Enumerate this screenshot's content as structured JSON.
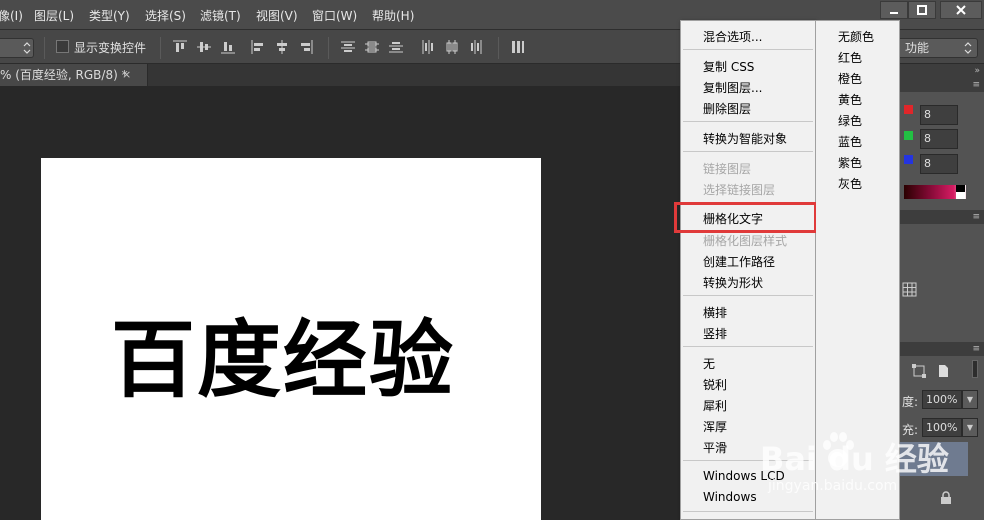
{
  "menubar": {
    "items": [
      "像(I)",
      "图层(L)",
      "类型(Y)",
      "选择(S)",
      "滤镜(T)",
      "视图(V)",
      "窗口(W)",
      "帮助(H)"
    ]
  },
  "options": {
    "checkbox_label": "显示变换控件",
    "workspace_label": "功能"
  },
  "document": {
    "tab_title": "% (百度经验, RGB/8) *",
    "close_glyph": "×",
    "canvas_text": "百度经验"
  },
  "panels": {
    "rgb_values": [
      "8",
      "8",
      "8"
    ],
    "swatch_colors": [
      "#e0262a",
      "#22c043",
      "#2434e0"
    ],
    "opacity_label": "度:",
    "opacity_value": "100%",
    "fill_label": "充:",
    "fill_value": "100%"
  },
  "context_menu": {
    "items": [
      {
        "label": "混合选项...",
        "disabled": false
      },
      {
        "label": "复制 CSS",
        "disabled": false
      },
      {
        "label": "复制图层...",
        "disabled": false
      },
      {
        "label": "删除图层",
        "disabled": false
      },
      {
        "label": "转换为智能对象",
        "disabled": false
      },
      {
        "label": "链接图层",
        "disabled": true
      },
      {
        "label": "选择链接图层",
        "disabled": true
      },
      {
        "label": "栅格化文字",
        "disabled": false,
        "highlighted": true
      },
      {
        "label": "栅格化图层样式",
        "disabled": true
      },
      {
        "label": "创建工作路径",
        "disabled": false
      },
      {
        "label": "转换为形状",
        "disabled": false
      },
      {
        "label": "横排",
        "disabled": false
      },
      {
        "label": "竖排",
        "disabled": false
      },
      {
        "label": "无",
        "disabled": false
      },
      {
        "label": "锐利",
        "disabled": false
      },
      {
        "label": "犀利",
        "disabled": false
      },
      {
        "label": "浑厚",
        "disabled": false
      },
      {
        "label": "平滑",
        "disabled": false
      },
      {
        "label": "Windows LCD",
        "disabled": false
      },
      {
        "label": "Windows",
        "disabled": false
      }
    ],
    "highlight_color": "#e03a3a",
    "color_items": [
      "无颜色",
      "红色",
      "橙色",
      "黄色",
      "绿色",
      "蓝色",
      "紫色",
      "灰色"
    ]
  },
  "watermark": {
    "brand": "Bai du 经验",
    "url": "jingyan.baidu.com"
  }
}
